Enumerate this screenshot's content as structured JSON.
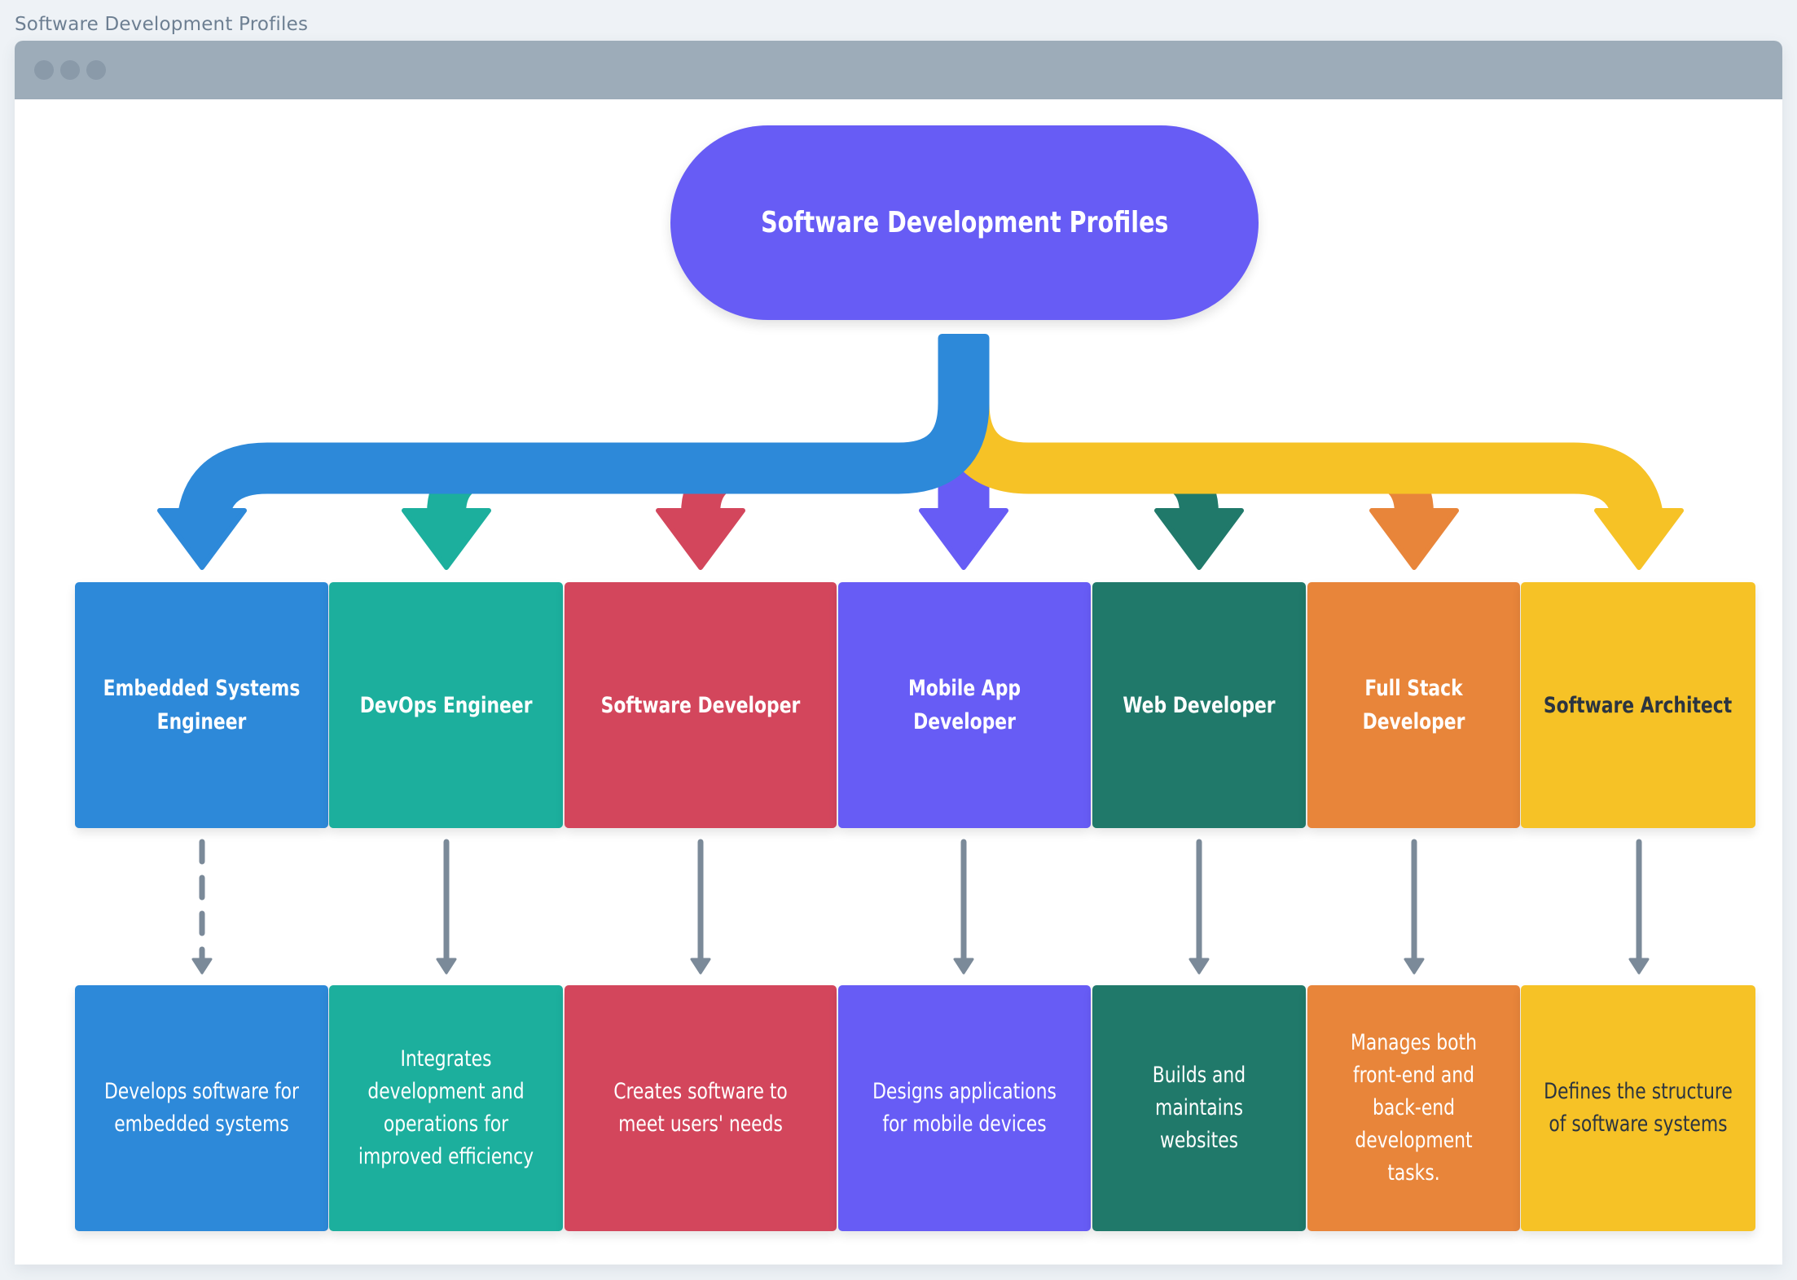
{
  "page": {
    "title": "Software Development Profiles"
  },
  "window": {
    "controls": [
      "dot",
      "dot",
      "dot"
    ]
  },
  "diagram": {
    "root": {
      "label": "Software Development Profiles",
      "color": "#675cf5"
    },
    "connector_colors": {
      "left_branch": "#2d89d9",
      "right_branch": "#f6c226",
      "connector": "#7b8a99"
    },
    "profiles": [
      {
        "role": "Embedded Systems Engineer",
        "description": "Develops software for embedded systems",
        "color": "#2d89d9",
        "text_color": "#ffffff",
        "connector_style": "dashed"
      },
      {
        "role": "DevOps Engineer",
        "description": "Integrates development and operations for improved efficiency",
        "color": "#1caf9d",
        "text_color": "#ffffff",
        "connector_style": "solid"
      },
      {
        "role": "Software Developer",
        "description": "Creates software to meet users' needs",
        "color": "#d3465c",
        "text_color": "#ffffff",
        "connector_style": "solid"
      },
      {
        "role": "Mobile App Developer",
        "description": "Designs applications for mobile devices",
        "color": "#675cf5",
        "text_color": "#ffffff",
        "connector_style": "solid"
      },
      {
        "role": "Web Developer",
        "description": "Builds and maintains websites",
        "color": "#20796a",
        "text_color": "#ffffff",
        "connector_style": "solid"
      },
      {
        "role": "Full Stack Developer",
        "description": "Manages both front-end and back-end development tasks.",
        "color": "#e8853a",
        "text_color": "#ffffff",
        "connector_style": "solid"
      },
      {
        "role": "Software Architect",
        "description": "Defines the structure of software systems",
        "color": "#f6c226",
        "text_color": "#2b3440",
        "connector_style": "solid"
      }
    ]
  }
}
